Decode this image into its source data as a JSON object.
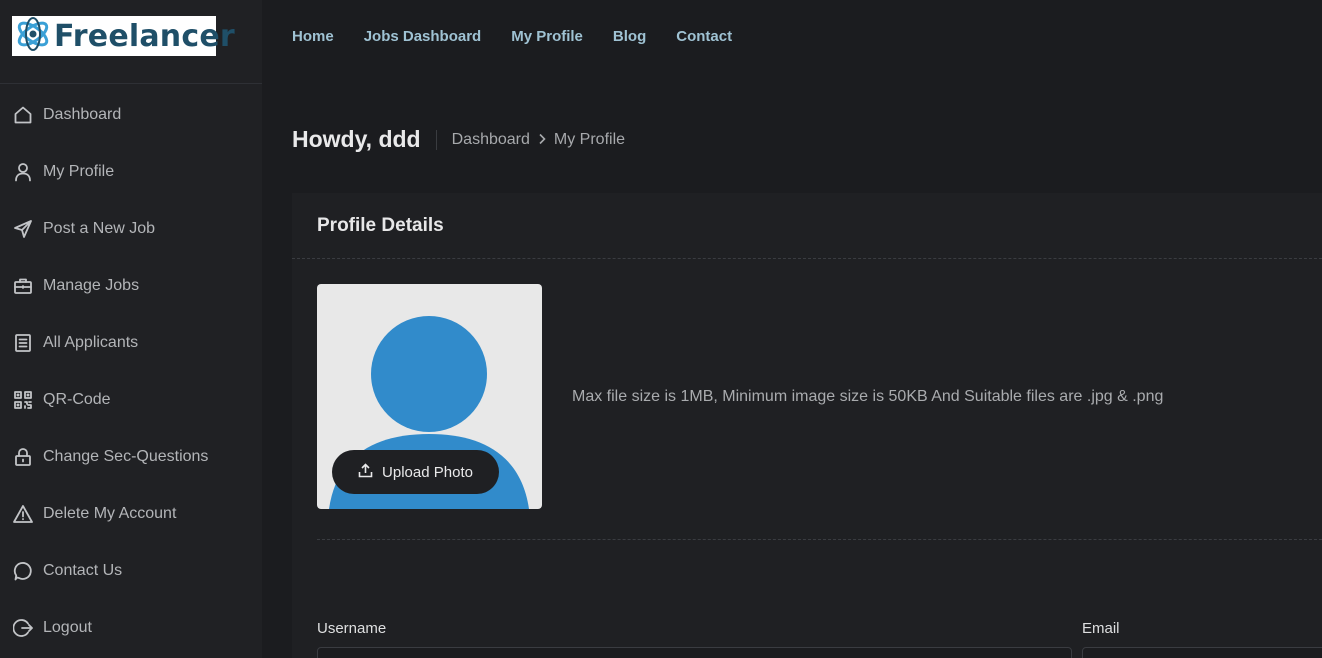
{
  "brand": {
    "name": "Freelancer",
    "logo_icon": "atom-logo-icon",
    "color": "#1f4f68"
  },
  "topnav": {
    "items": [
      {
        "label": "Home"
      },
      {
        "label": "Jobs Dashboard"
      },
      {
        "label": "My Profile"
      },
      {
        "label": "Blog"
      },
      {
        "label": "Contact"
      }
    ]
  },
  "sidebar": {
    "items": [
      {
        "label": "Dashboard",
        "icon": "home-icon"
      },
      {
        "label": "My Profile",
        "icon": "user-icon"
      },
      {
        "label": "Post a New Job",
        "icon": "send-icon"
      },
      {
        "label": "Manage Jobs",
        "icon": "briefcase-icon"
      },
      {
        "label": "All Applicants",
        "icon": "document-list-icon"
      },
      {
        "label": "QR-Code",
        "icon": "qr-code-icon"
      },
      {
        "label": "Change Sec-Questions",
        "icon": "lock-icon"
      },
      {
        "label": "Delete My Account",
        "icon": "warning-icon"
      },
      {
        "label": "Contact Us",
        "icon": "chat-bubble-icon"
      },
      {
        "label": "Logout",
        "icon": "logout-icon"
      }
    ]
  },
  "header": {
    "greeting": "Howdy, ddd",
    "breadcrumb": [
      "Dashboard",
      "My Profile"
    ]
  },
  "profile": {
    "title": "Profile Details",
    "upload_label": "Upload Photo",
    "hint": "Max file size is 1MB, Minimum image size is 50KB And Suitable files are .jpg & .png",
    "avatar_color": "#318bcb"
  },
  "form": {
    "username_label": "Username",
    "username_value": "",
    "email_label": "Email",
    "email_value": ""
  },
  "colors": {
    "accent_link": "#9fc2d3",
    "background": "#1b1c1f",
    "sidebar": "#202124"
  }
}
